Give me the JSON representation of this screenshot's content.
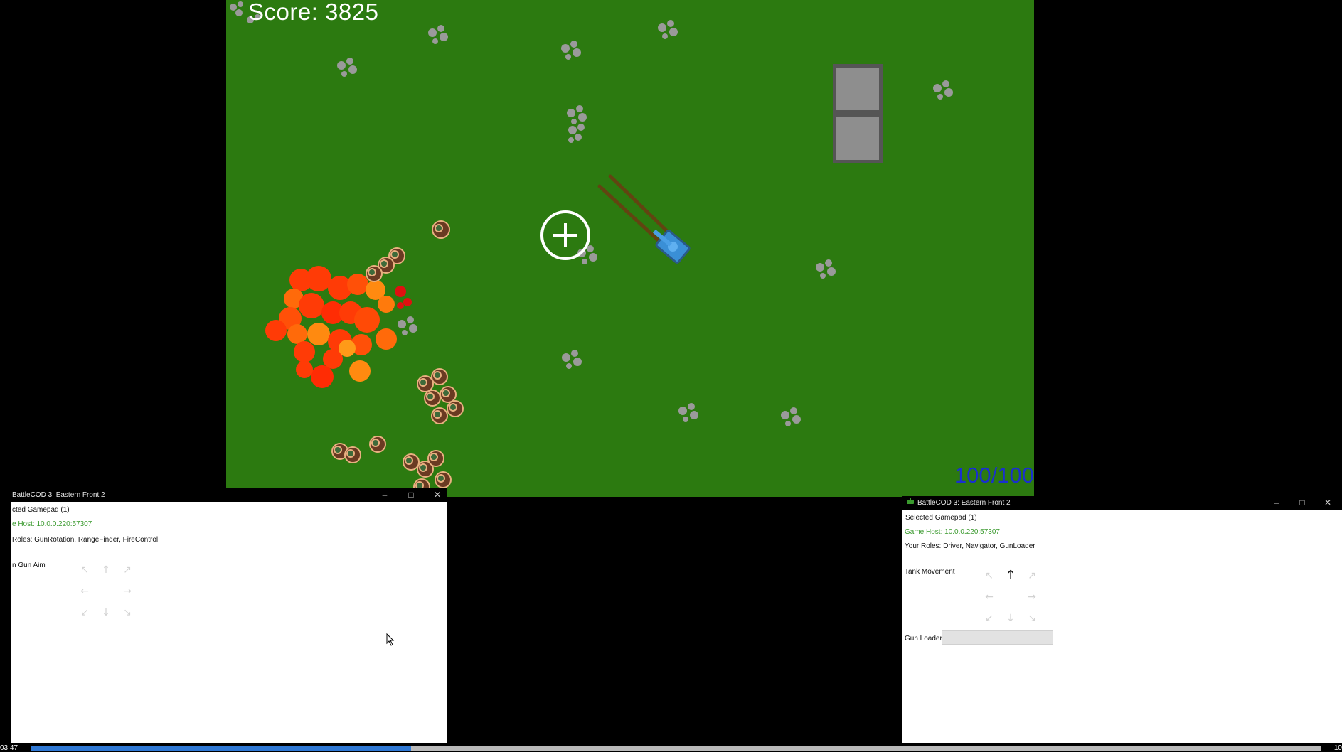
{
  "game": {
    "score_text": "Score: 3825",
    "health_text": "100/100"
  },
  "left_window": {
    "title": "BattleCOD 3: Eastern Front 2",
    "controls": {
      "minimize": "–",
      "maximize": "□",
      "close": "✕"
    },
    "selected_gamepad": "cted Gamepad (1)",
    "game_host": "e Host: 10.0.0.220:57307",
    "roles": "Roles: GunRotation, RangeFinder, FireControl",
    "section_label": "n Gun Aim"
  },
  "right_window": {
    "title": "BattleCOD 3: Eastern Front 2",
    "controls": {
      "minimize": "–",
      "maximize": "□",
      "close": "✕"
    },
    "selected_gamepad": "Selected Gamepad (1)",
    "game_host": "Game Host: 10.0.0.220:57307",
    "roles": "Your Roles: Driver, Navigator, GunLoader",
    "tank_movement_label": "Tank Movement",
    "gun_loader_label": "Gun Loader",
    "active_direction": "up"
  },
  "dpad_glyphs": [
    "↖",
    "↑",
    "↗",
    "←",
    "→",
    "↙",
    "↓",
    "↘"
  ],
  "playback": {
    "time_left": "03:47",
    "time_right": "10",
    "progress": 0.295
  },
  "colors": {
    "grass": "#2c7a10",
    "tank": "#3a8fd6",
    "explosion": "#ff4a0a",
    "health_text": "#1a2fd0",
    "host_text": "#3a9a2e"
  }
}
